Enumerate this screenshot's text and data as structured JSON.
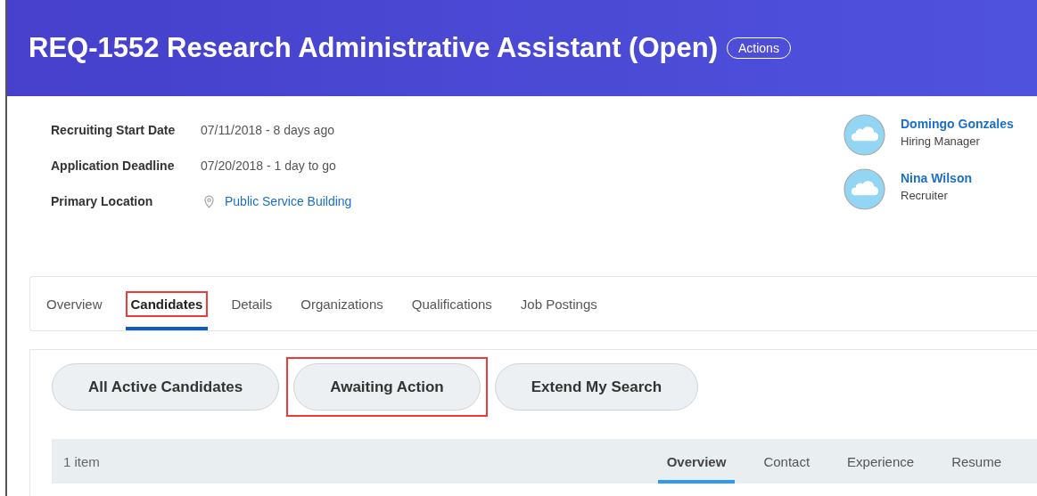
{
  "header": {
    "title": "REQ-1552 Research Administrative Assistant (Open)",
    "actions_button": "Actions"
  },
  "fields": [
    {
      "label": "Recruiting Start Date",
      "value": "07/11/2018 - 8 days ago",
      "kind": "text"
    },
    {
      "label": "Application Deadline",
      "value": "07/20/2018 - 1 day to go",
      "kind": "text"
    },
    {
      "label": "Primary Location",
      "value": "Public Service Building",
      "kind": "location"
    }
  ],
  "people": [
    {
      "name": "Domingo Gonzales",
      "role": "Hiring Manager"
    },
    {
      "name": "Nina Wilson",
      "role": "Recruiter"
    }
  ],
  "tabs": [
    {
      "label": "Overview",
      "selected": false,
      "highlighted": false
    },
    {
      "label": "Candidates",
      "selected": true,
      "highlighted": true
    },
    {
      "label": "Details",
      "selected": false,
      "highlighted": false
    },
    {
      "label": "Organizations",
      "selected": false,
      "highlighted": false
    },
    {
      "label": "Qualifications",
      "selected": false,
      "highlighted": false
    },
    {
      "label": "Job Postings",
      "selected": false,
      "highlighted": false
    }
  ],
  "filters": [
    {
      "label": "All Active Candidates",
      "highlighted": false
    },
    {
      "label": "Awaiting Action",
      "highlighted": true
    },
    {
      "label": "Extend My Search",
      "highlighted": false
    }
  ],
  "table": {
    "count": "1 item",
    "view_tabs": [
      {
        "label": "Overview",
        "selected": true
      },
      {
        "label": "Contact",
        "selected": false
      },
      {
        "label": "Experience",
        "selected": false
      },
      {
        "label": "Resume",
        "selected": false
      }
    ]
  }
}
